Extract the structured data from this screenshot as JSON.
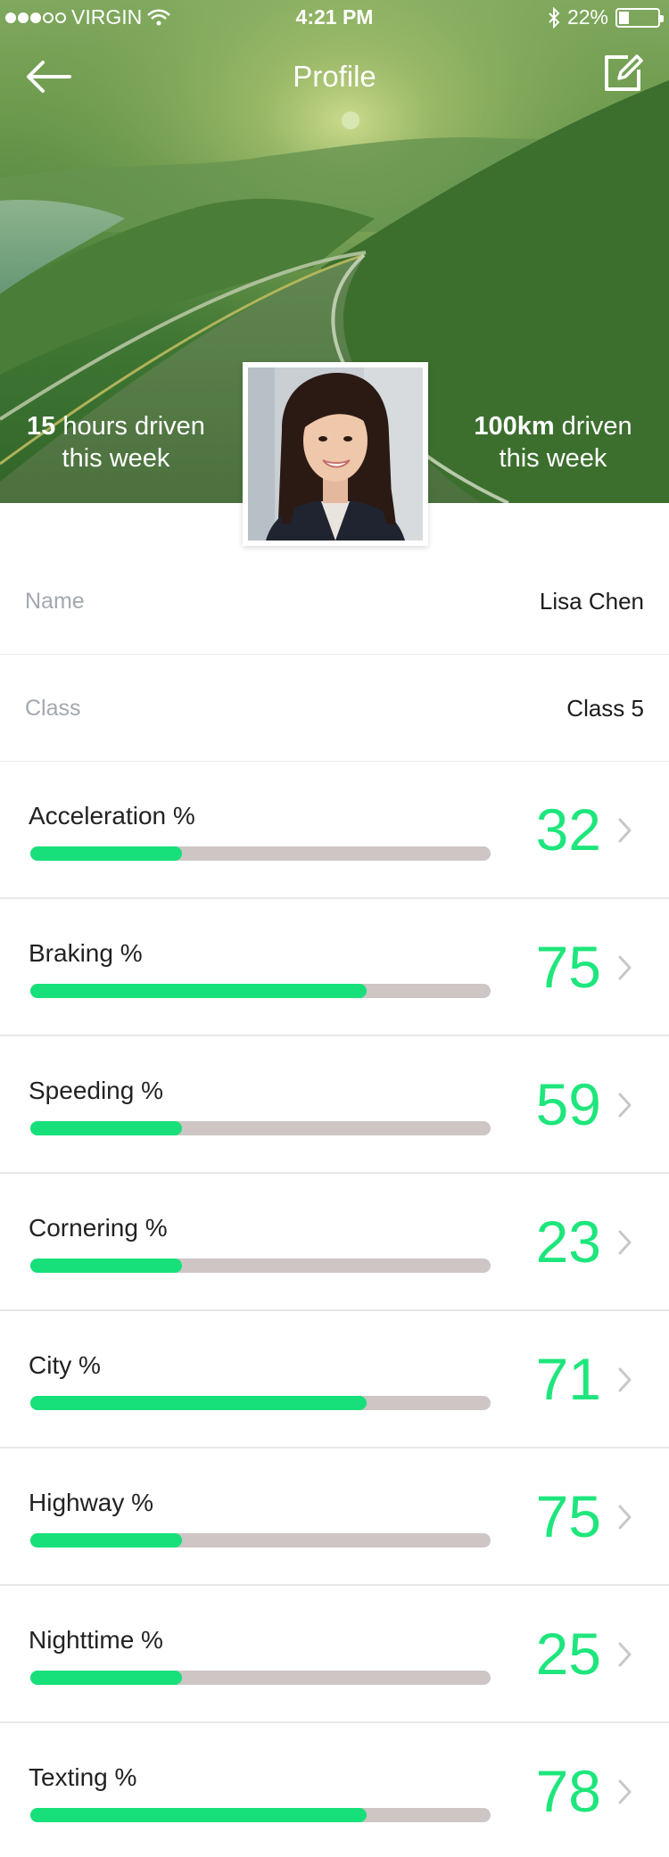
{
  "status_bar": {
    "carrier": "VIRGIN",
    "time": "4:21 PM",
    "battery": "22%",
    "icons": [
      "signal-dots-icon",
      "wifi-icon",
      "bluetooth-icon",
      "battery-icon"
    ]
  },
  "nav": {
    "title": "Profile",
    "back_icon": "arrow-left-icon",
    "edit_icon": "edit-icon"
  },
  "hero": {
    "left_stat": {
      "value": "15",
      "text": " hours driven",
      "sub": "this week"
    },
    "right_stat": {
      "value": "100km",
      "text": " driven",
      "sub": "this week"
    }
  },
  "profile": {
    "name_label": "Name",
    "name_value": "Lisa Chen",
    "class_label": "Class",
    "class_value": "Class 5"
  },
  "metrics": [
    {
      "label": "Acceleration %",
      "value": "32",
      "bar_fraction": 0.33
    },
    {
      "label": "Braking %",
      "value": "75",
      "bar_fraction": 0.73
    },
    {
      "label": "Speeding %",
      "value": "59",
      "bar_fraction": 0.33
    },
    {
      "label": "Cornering %",
      "value": "23",
      "bar_fraction": 0.33
    },
    {
      "label": "City %",
      "value": "71",
      "bar_fraction": 0.73
    },
    {
      "label": "Highway %",
      "value": "75",
      "bar_fraction": 0.33
    },
    {
      "label": "Nighttime %",
      "value": "25",
      "bar_fraction": 0.33
    },
    {
      "label": "Texting %",
      "value": "78",
      "bar_fraction": 0.73
    }
  ],
  "colors": {
    "accent_green": "#1ee67c",
    "bar_fill": "#17e07a",
    "bar_track": "#cdc6c5",
    "label_gray": "#a3a8b0"
  }
}
